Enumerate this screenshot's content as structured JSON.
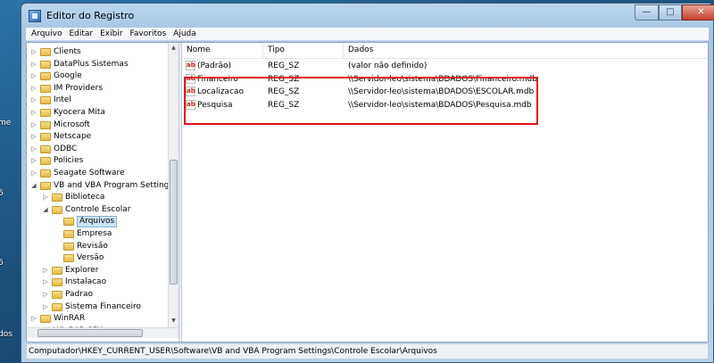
{
  "window": {
    "title": "Editor do Registro"
  },
  "menubar": [
    "Arquivo",
    "Editar",
    "Exibir",
    "Favoritos",
    "Ajuda"
  ],
  "tree": [
    {
      "label": "Clients",
      "level": 0,
      "expanded": false
    },
    {
      "label": "DataPlus Sistemas",
      "level": 0,
      "expanded": false
    },
    {
      "label": "Google",
      "level": 0,
      "expanded": false
    },
    {
      "label": "IM Providers",
      "level": 0,
      "expanded": false
    },
    {
      "label": "Intel",
      "level": 0,
      "expanded": false
    },
    {
      "label": "Kyocera Mita",
      "level": 0,
      "expanded": false
    },
    {
      "label": "Microsoft",
      "level": 0,
      "expanded": false
    },
    {
      "label": "Netscape",
      "level": 0,
      "expanded": false
    },
    {
      "label": "ODBC",
      "level": 0,
      "expanded": false
    },
    {
      "label": "Policies",
      "level": 0,
      "expanded": false
    },
    {
      "label": "Seagate Software",
      "level": 0,
      "expanded": false
    },
    {
      "label": "VB and VBA Program Settings",
      "level": 0,
      "expanded": true
    },
    {
      "label": "Biblioteca",
      "level": 1,
      "expanded": false
    },
    {
      "label": "Controle Escolar",
      "level": 1,
      "expanded": true
    },
    {
      "label": "Arquivos",
      "level": 2,
      "selected": true
    },
    {
      "label": "Empresa",
      "level": 2
    },
    {
      "label": "Revisão",
      "level": 2
    },
    {
      "label": "Versão",
      "level": 2
    },
    {
      "label": "Explorer",
      "level": 1,
      "expanded": false
    },
    {
      "label": "Instalacao",
      "level": 1,
      "expanded": false
    },
    {
      "label": "Padrao",
      "level": 1,
      "expanded": false
    },
    {
      "label": "Sistema Financeiro",
      "level": 1,
      "expanded": false
    },
    {
      "label": "WinRAR",
      "level": 0,
      "expanded": false
    },
    {
      "label": "WinRAR SFX",
      "level": 0,
      "expanded": false
    }
  ],
  "list": {
    "columns": [
      "Nome",
      "Tipo",
      "Dados"
    ],
    "rows": [
      {
        "name": "(Padrão)",
        "type": "REG_SZ",
        "data": "(valor não definido)"
      },
      {
        "name": "Financeiro",
        "type": "REG_SZ",
        "data": "\\\\Servidor-leo\\sistema\\BDADOS\\Financeiro.mdb"
      },
      {
        "name": "Localizacao",
        "type": "REG_SZ",
        "data": "\\\\Servidor-leo\\sistema\\BDADOS\\ESCOLAR.mdb"
      },
      {
        "name": "Pesquisa",
        "type": "REG_SZ",
        "data": "\\\\Servidor-leo\\sistema\\BDADOS\\Pesquisa.mdb"
      }
    ]
  },
  "statusbar": "Computador\\HKEY_CURRENT_USER\\Software\\VB and VBA Program Settings\\Controle Escolar\\Arquivos",
  "desktop_labels": [
    "me",
    "6",
    "6",
    "dos"
  ],
  "colors": {
    "highlight_border": "#e0111a",
    "selection": "#cde3f7",
    "string_icon": "#c5281c"
  },
  "icons": {
    "app": "regedit-icon",
    "folder": "folder-icon",
    "string_value": "ab-string-icon"
  }
}
